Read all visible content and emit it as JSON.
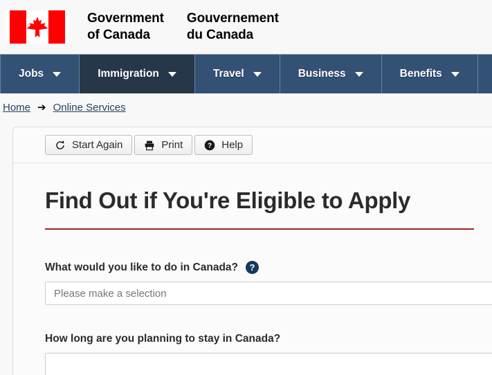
{
  "header": {
    "flag_icon": "canada-flag-icon",
    "wordmark_en": "Government\nof Canada",
    "wordmark_fr": "Gouvernement\ndu Canada"
  },
  "nav": {
    "items": [
      {
        "label": "Jobs",
        "icon": "chevron-down-icon",
        "active": false
      },
      {
        "label": "Immigration",
        "icon": "chevron-down-icon",
        "active": true
      },
      {
        "label": "Travel",
        "icon": "chevron-down-icon",
        "active": false
      },
      {
        "label": "Business",
        "icon": "chevron-down-icon",
        "active": false
      },
      {
        "label": "Benefits",
        "icon": "chevron-down-icon",
        "active": false
      }
    ],
    "background": "#335075",
    "active_background": "#26374a"
  },
  "breadcrumb": {
    "home": "Home",
    "separator": "➔",
    "current": "Online Services"
  },
  "toolbar": {
    "start_again": "Start Again",
    "print": "Print",
    "help": "Help"
  },
  "main": {
    "title": "Find Out if You're Eligible to Apply",
    "rule_color": "#9b2423",
    "fields": [
      {
        "label": "What would you like to do in Canada?",
        "help": "?",
        "value": "Please make a selection"
      },
      {
        "label": "How long are you planning to stay in Canada?",
        "value": ""
      }
    ]
  }
}
